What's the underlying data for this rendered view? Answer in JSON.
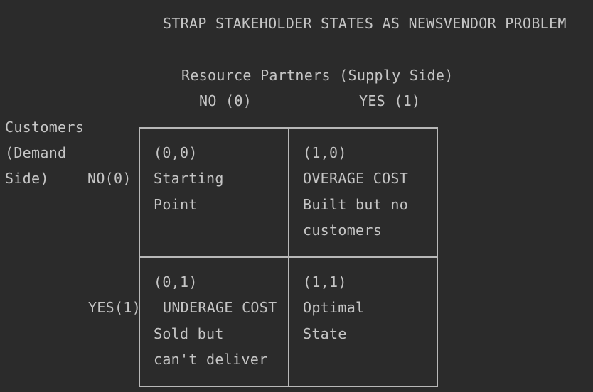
{
  "title": "STRAP STAKEHOLDER STATES AS NEWSVENDOR PROBLEM",
  "supply_axis": {
    "label": "Resource Partners (Supply Side)",
    "col_no": "NO (0)",
    "col_yes": "YES (1)"
  },
  "demand_axis": {
    "line1": "Customers",
    "line2": "(Demand",
    "line3": "Side)",
    "row_no": "NO(0)",
    "row_yes": "YES(1)"
  },
  "cells": {
    "c00": {
      "coord": "(0,0)",
      "line1": "Starting",
      "line2": "Point"
    },
    "c10": {
      "coord": "(1,0)",
      "line1": "OVERAGE COST",
      "line2": "Built but no",
      "line3": "customers"
    },
    "c01": {
      "coord": "(0,1)",
      "line1": "UNDERAGE COST",
      "line2": "Sold but",
      "line3": "can't deliver"
    },
    "c11": {
      "coord": "(1,1)",
      "line1": "Optimal",
      "line2": "State"
    }
  }
}
